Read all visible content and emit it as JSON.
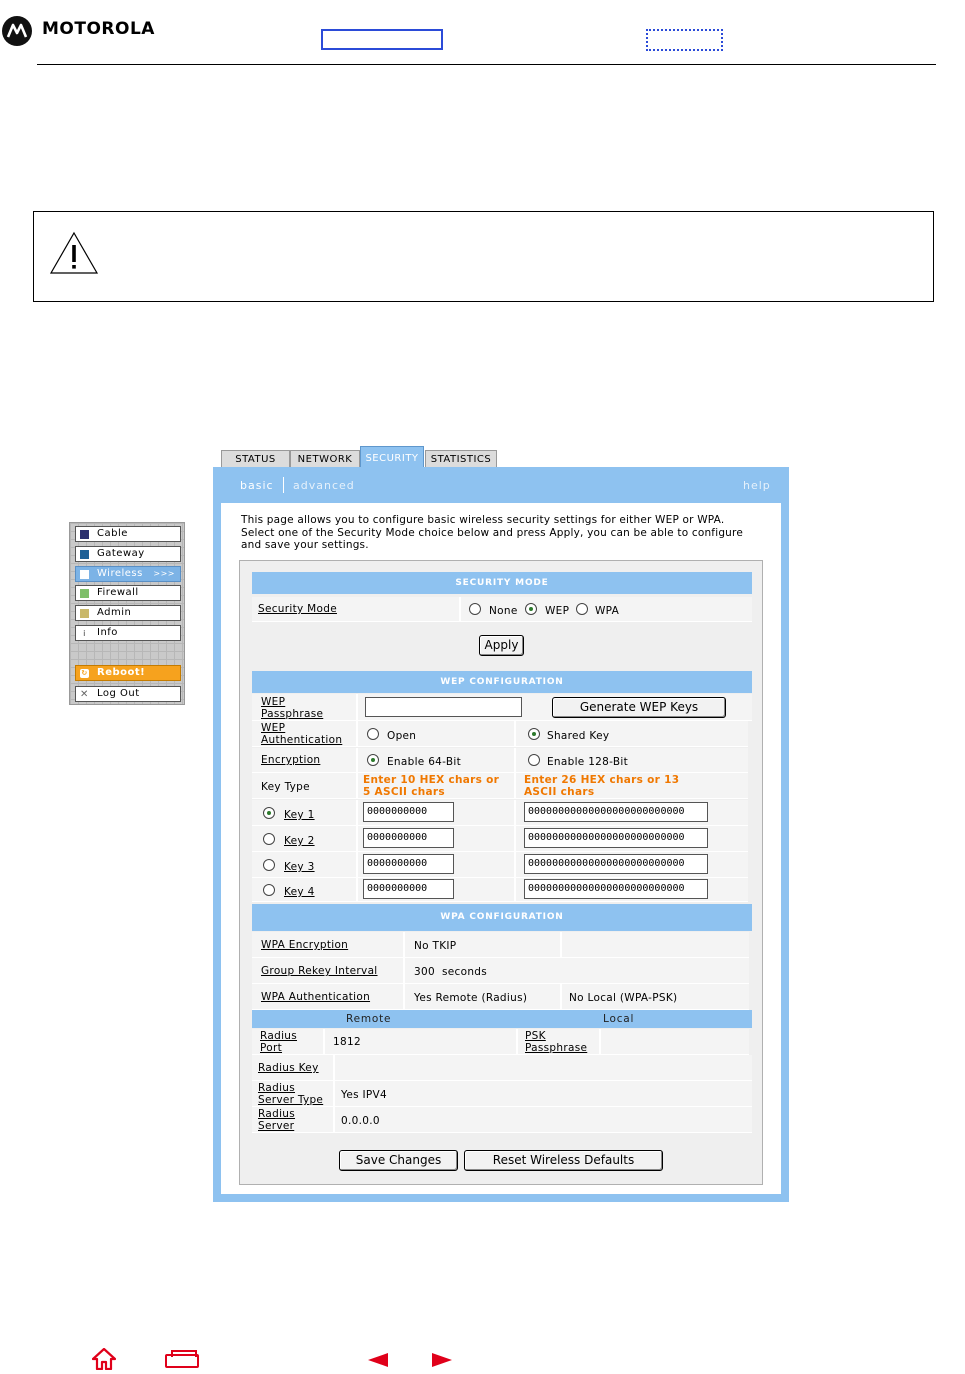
{
  "header": {
    "brand": "MOTOROLA"
  },
  "tabs": [
    "STATUS",
    "NETWORK",
    "SECURITY",
    "STATISTICS"
  ],
  "subnav": {
    "basic": "basic",
    "advanced": "advanced",
    "help": "help"
  },
  "leftnav": {
    "items": [
      "Cable",
      "Gateway",
      "Wireless",
      "Firewall",
      "Admin",
      "Info",
      "Reboot!",
      "Log Out"
    ],
    "wireless_arrow": ">>>",
    "colors": {
      "cable": "#2a2f6e",
      "gateway": "#1d5f96",
      "wireless": "#ffffff",
      "firewall": "#7fbf6a",
      "admin": "#c9b86a"
    }
  },
  "intro": "This page allows you to configure basic wireless security settings for either WEP or WPA. Select one of the Security Mode choice below and press Apply, you can be able to configure and save your settings.",
  "security_mode": {
    "header": "SECURITY MODE",
    "label": "Security Mode",
    "options": [
      "None",
      "WEP",
      "WPA"
    ],
    "selected": "WEP",
    "apply": "Apply"
  },
  "wep": {
    "header": "WEP CONFIGURATION",
    "passphrase_label": "WEP Passphrase",
    "passphrase_value": "",
    "generate_button": "Generate WEP Keys",
    "auth_label": "WEP Authentication",
    "auth_options": [
      "Open",
      "Shared Key"
    ],
    "auth_selected": "Shared Key",
    "encryption_label": "Encryption",
    "encryption_options": [
      "Enable 64-Bit",
      "Enable 128-Bit"
    ],
    "encryption_selected": "Enable 64-Bit",
    "key_type_label": "Key Type",
    "hint_64": "Enter 10 HEX chars or 5 ASCII chars",
    "hint_128": "Enter 26 HEX chars or 13 ASCII chars",
    "keys": [
      {
        "label": "Key 1",
        "value64": "0000000000",
        "value128": "00000000000000000000000000"
      },
      {
        "label": "Key 2",
        "value64": "0000000000",
        "value128": "00000000000000000000000000"
      },
      {
        "label": "Key 3",
        "value64": "0000000000",
        "value128": "00000000000000000000000000"
      },
      {
        "label": "Key 4",
        "value64": "0000000000",
        "value128": "00000000000000000000000000"
      }
    ],
    "selected_key": "Key 1"
  },
  "wpa": {
    "header": "WPA CONFIGURATION",
    "encryption_label": "WPA Encryption",
    "encryption_value": "No TKIP",
    "rekey_label": "Group Rekey Interval",
    "rekey_value": "300",
    "rekey_unit": "seconds",
    "auth_label": "WPA Authentication",
    "auth_remote": "Yes Remote (Radius)",
    "auth_local": "No Local (WPA-PSK)",
    "col_remote": "Remote",
    "col_local": "Local",
    "radius_port_label": "Radius Port",
    "radius_port_value": "1812",
    "psk_label": "PSK Passphrase",
    "psk_value": "",
    "radius_key_label": "Radius Key",
    "radius_key_value": "",
    "radius_type_label": "Radius Server Type",
    "radius_type_value": "Yes IPV4",
    "radius_server_label": "Radius Server",
    "radius_server_value": "0.0.0.0"
  },
  "buttons": {
    "save": "Save Changes",
    "reset": "Reset Wireless Defaults"
  },
  "footer_icons": [
    "home-icon",
    "print-icon",
    "previous-icon",
    "next-icon"
  ]
}
